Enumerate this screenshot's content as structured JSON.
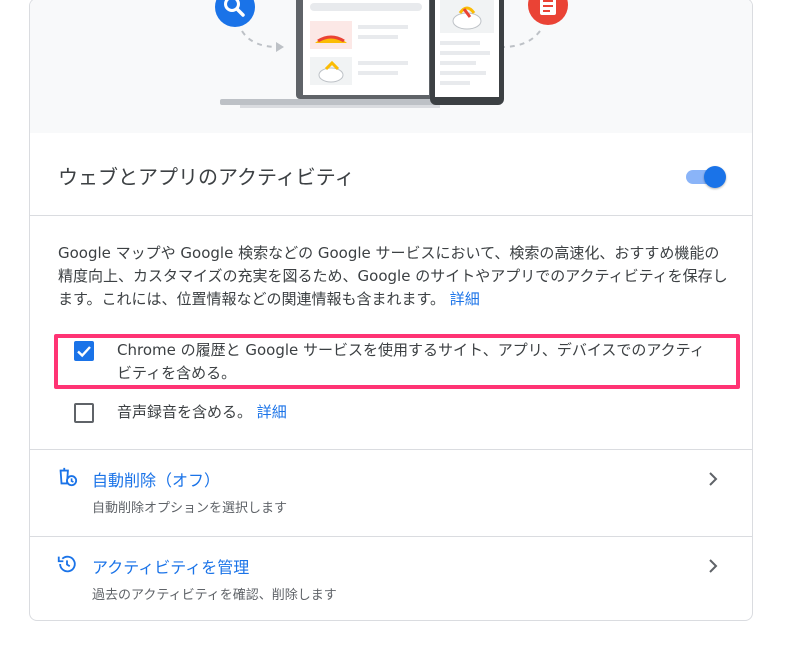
{
  "activity": {
    "title": "ウェブとアプリのアクティビティ",
    "toggle_on": true,
    "description": "Google マップや Google 検索などの Google サービスにおいて、検索の高速化、おすすめ機能の精度向上、カスタマイズの充実を図るため、Google のサイトやアプリでのアクティビティを保存します。これには、位置情報などの関連情報も含まれます。",
    "details_link": "詳細"
  },
  "options": [
    {
      "label": "Chrome の履歴と Google サービスを使用するサイト、アプリ、デバイスでのアクティビティを含める。",
      "checked": true,
      "link": ""
    },
    {
      "label": "音声録音を含める。",
      "checked": false,
      "link": "詳細"
    }
  ],
  "nav": [
    {
      "title": "自動削除（オフ）",
      "subtitle": "自動削除オプションを選択します",
      "icon": "auto-delete-icon"
    },
    {
      "title": "アクティビティを管理",
      "subtitle": "過去のアクティビティを確認、削除します",
      "icon": "history-icon"
    }
  ],
  "colors": {
    "accent": "#1a73e8",
    "highlight": "#ff3374",
    "search_badge": "#1a73e8",
    "doc_badge": "#ea4335"
  },
  "icons": [
    "search-icon",
    "document-icon",
    "laptop-illustration",
    "phone-illustration",
    "chevron-right-icon"
  ]
}
